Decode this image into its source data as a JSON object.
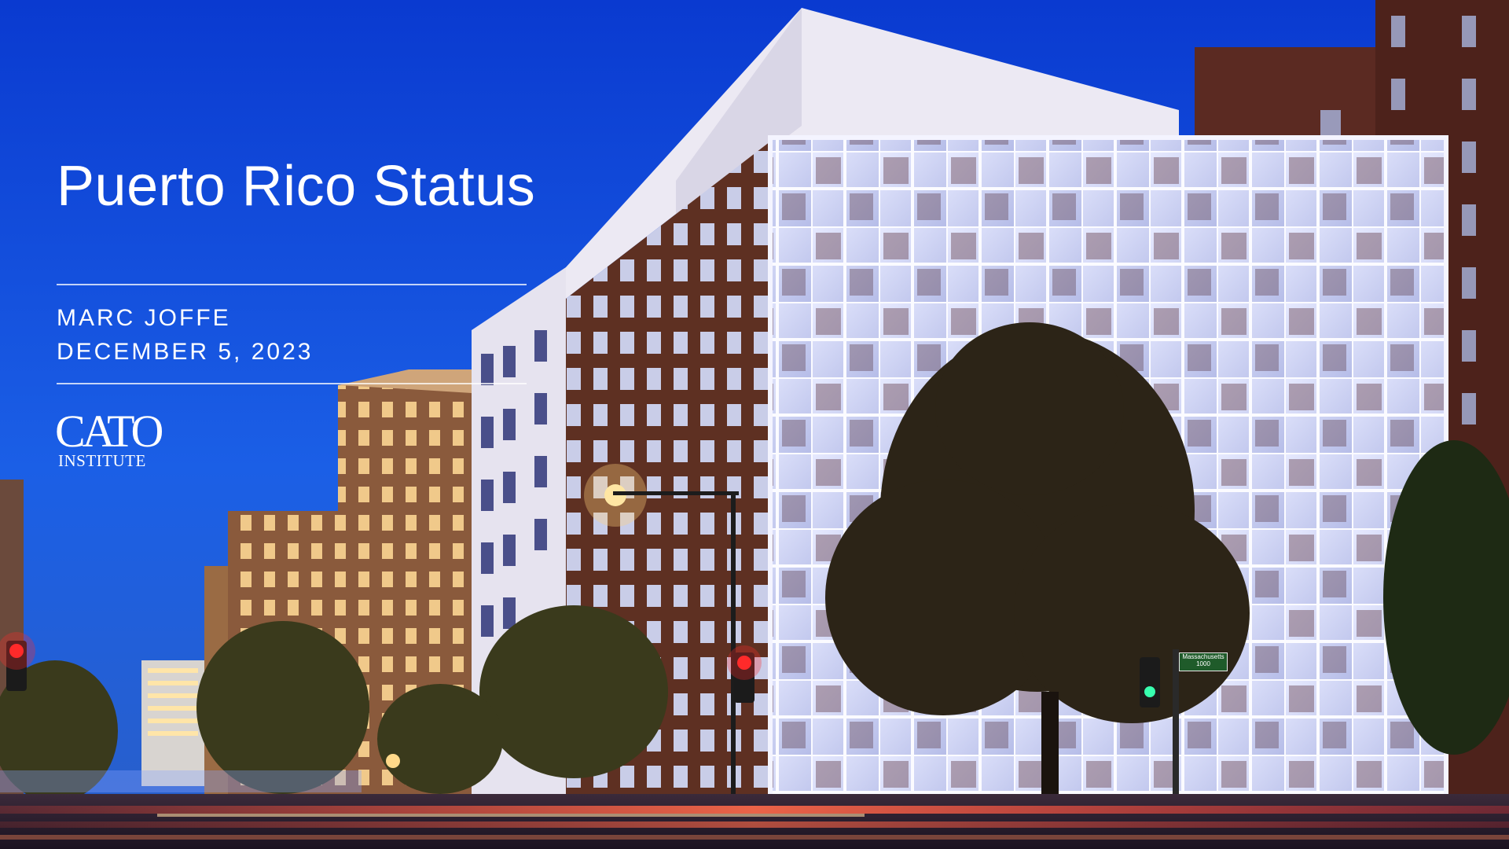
{
  "slide": {
    "title": "Puerto Rico Status",
    "author": "MARC JOFFE",
    "date": "DECEMBER 5, 2023"
  },
  "logo": {
    "mark": "CATO",
    "sub": "INSTITUTE"
  },
  "photo": {
    "street_sign": "Massachusetts 1000"
  },
  "colors": {
    "sky_top": "#0b3fd3",
    "sky_mid": "#1a5ee0",
    "text": "#ffffff",
    "brick": "#6b3a2a",
    "glass_light": "#dfe6ff"
  }
}
